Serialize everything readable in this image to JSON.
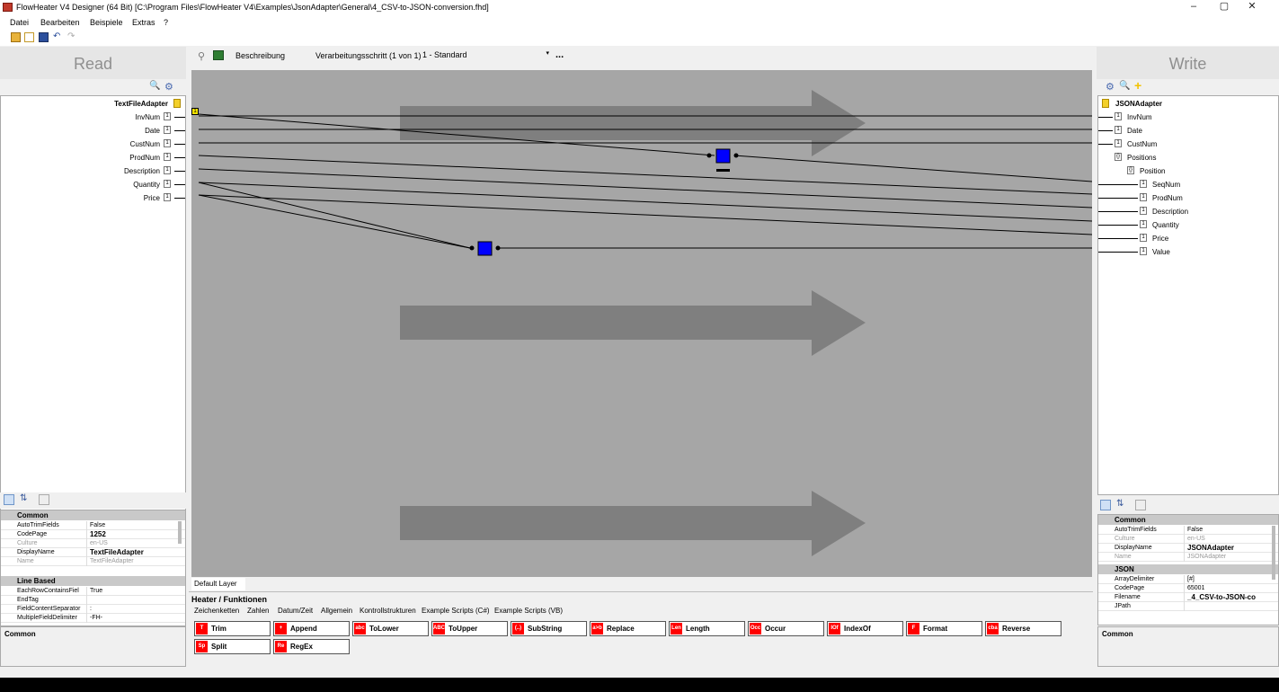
{
  "window": {
    "title": "FlowHeater V4 Designer (64 Bit) [C:\\Program Files\\FlowHeater V4\\Examples\\JsonAdapter\\General\\4_CSV-to-JSON-conversion.fhd]",
    "minimize": "–",
    "maximize": "▢",
    "close": "✕"
  },
  "menu": [
    "Datei",
    "Bearbeiten",
    "Beispiele",
    "Extras",
    "?"
  ],
  "left": {
    "header": "Read",
    "adapter": "TextFileAdapter",
    "fields": [
      "InvNum",
      "Date",
      "CustNum",
      "ProdNum",
      "Description",
      "Quantity",
      "Price"
    ],
    "props": {
      "cat_common": "Common",
      "rows1": [
        {
          "k": "AutoTrimFields",
          "v": "False"
        },
        {
          "k": "CodePage",
          "v": "1252"
        },
        {
          "k": "Culture",
          "v": "en-US"
        },
        {
          "k": "DisplayName",
          "v": "TextFileAdapter"
        },
        {
          "k": "Name",
          "v": "TextFileAdapter"
        }
      ],
      "cat_line": "Line Based",
      "rows2": [
        {
          "k": "EachRowContainsFiel",
          "v": "True"
        },
        {
          "k": "EndTag",
          "v": ""
        },
        {
          "k": "FieldContentSeparator",
          "v": ":"
        },
        {
          "k": "MultipleFieldDelimiter",
          "v": "-FH-"
        }
      ],
      "description": "Common"
    }
  },
  "center": {
    "description_label": "Beschreibung",
    "step_label": "Verarbeitungsschritt (1 von 1)",
    "step_value": "1 - Standard",
    "more": "...",
    "pin_badge": "1",
    "layer_tab": "Default Layer",
    "heater_title": "Heater / Funktionen",
    "tabs": [
      "Zeichenketten",
      "Zahlen",
      "Datum/Zeit",
      "Allgemein",
      "Kontrollstrukturen",
      "Example Scripts (C#)",
      "Example Scripts (VB)"
    ],
    "functions": [
      "Trim",
      "Append",
      "ToLower",
      "ToUpper",
      "SubString",
      "Replace",
      "Length",
      "Occur",
      "IndexOf",
      "Format",
      "Reverse",
      "Split",
      "RegEx"
    ],
    "func_icons": [
      "T",
      "+",
      "abc",
      "ABC",
      "(..)",
      "a>b",
      "Len",
      "Occ",
      "IOf",
      "F",
      "cba",
      "Sp",
      "Re"
    ]
  },
  "right": {
    "header": "Write",
    "adapter": "JSONAdapter",
    "tree": [
      {
        "label": "InvNum",
        "indent": 0
      },
      {
        "label": "Date",
        "indent": 0
      },
      {
        "label": "CustNum",
        "indent": 0
      },
      {
        "label": "Positions",
        "indent": 0
      },
      {
        "label": "Position",
        "indent": 1
      },
      {
        "label": "SeqNum",
        "indent": 2
      },
      {
        "label": "ProdNum",
        "indent": 2
      },
      {
        "label": "Description",
        "indent": 2
      },
      {
        "label": "Quantity",
        "indent": 2
      },
      {
        "label": "Price",
        "indent": 2
      },
      {
        "label": "Value",
        "indent": 2
      }
    ],
    "props": {
      "cat_common": "Common",
      "rows1": [
        {
          "k": "AutoTrimFields",
          "v": "False"
        },
        {
          "k": "Culture",
          "v": "en-US"
        },
        {
          "k": "DisplayName",
          "v": "JSONAdapter"
        },
        {
          "k": "Name",
          "v": "JSONAdapter"
        }
      ],
      "cat_json": "JSON",
      "rows2": [
        {
          "k": "ArrayDelimiter",
          "v": "[#]"
        },
        {
          "k": "CodePage",
          "v": "65001"
        },
        {
          "k": "Filename",
          "v": "_4_CSV-to-JSON-co"
        },
        {
          "k": "JPath",
          "v": ""
        }
      ],
      "description": "Common"
    }
  },
  "colors": {
    "canvas": "#a6a6a6",
    "arrow": "#7f7f7f",
    "node": "#0000ff",
    "func_icon": "#ff0000"
  }
}
